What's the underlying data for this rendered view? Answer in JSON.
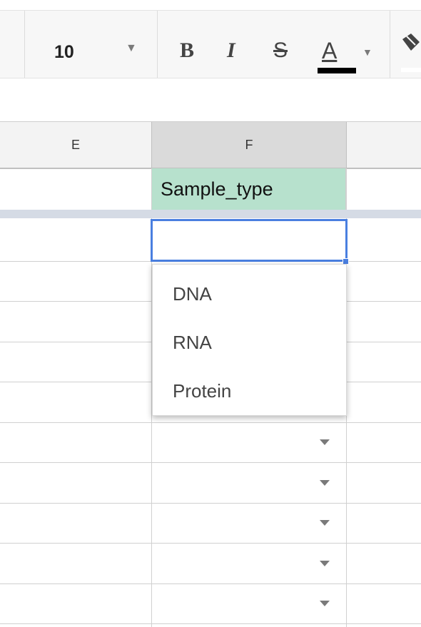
{
  "toolbar": {
    "font_size": "10",
    "font_size_caret_icon": "chevron-down-icon",
    "bold_label": "B",
    "italic_label": "I",
    "strike_label": "S",
    "text_color_label": "A",
    "text_color_caret_icon": "chevron-down-icon",
    "text_color_value": "#000000",
    "fill_icon": "paint-bucket-icon"
  },
  "grid": {
    "columns": [
      "E",
      "F"
    ],
    "header_cell": {
      "value": "Sample_type",
      "background": "#b7e1cd"
    },
    "active_cell_value": "",
    "selection_color": "#4a7fe0"
  },
  "dropdown": {
    "options": [
      "DNA",
      "RNA",
      "Protein"
    ]
  },
  "validation_rows": {
    "count_visible": 5,
    "icon": "chevron-down-icon"
  }
}
